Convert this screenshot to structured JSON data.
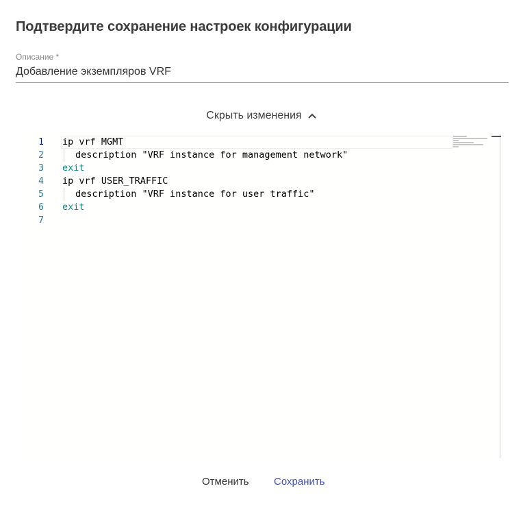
{
  "dialog": {
    "title": "Подтвердите сохранение настроек конфигурации",
    "description_label": "Описание *",
    "description_value": "Добавление экземпляров VRF"
  },
  "diff_toggle": {
    "label": "Скрыть изменения",
    "icon": "chevron-up-icon"
  },
  "editor": {
    "line_numbers": [
      "1",
      "2",
      "3",
      "4",
      "5",
      "6",
      "7"
    ],
    "lines": [
      "ip vrf MGMT",
      "description \"VRF instance for management network\"",
      "exit",
      "ip vrf USER_TRAFFIC",
      "description \"VRF instance for user traffic\"",
      "exit",
      ""
    ]
  },
  "actions": {
    "cancel": "Отменить",
    "save": "Сохранить",
    "accent": "#3f51b5"
  }
}
